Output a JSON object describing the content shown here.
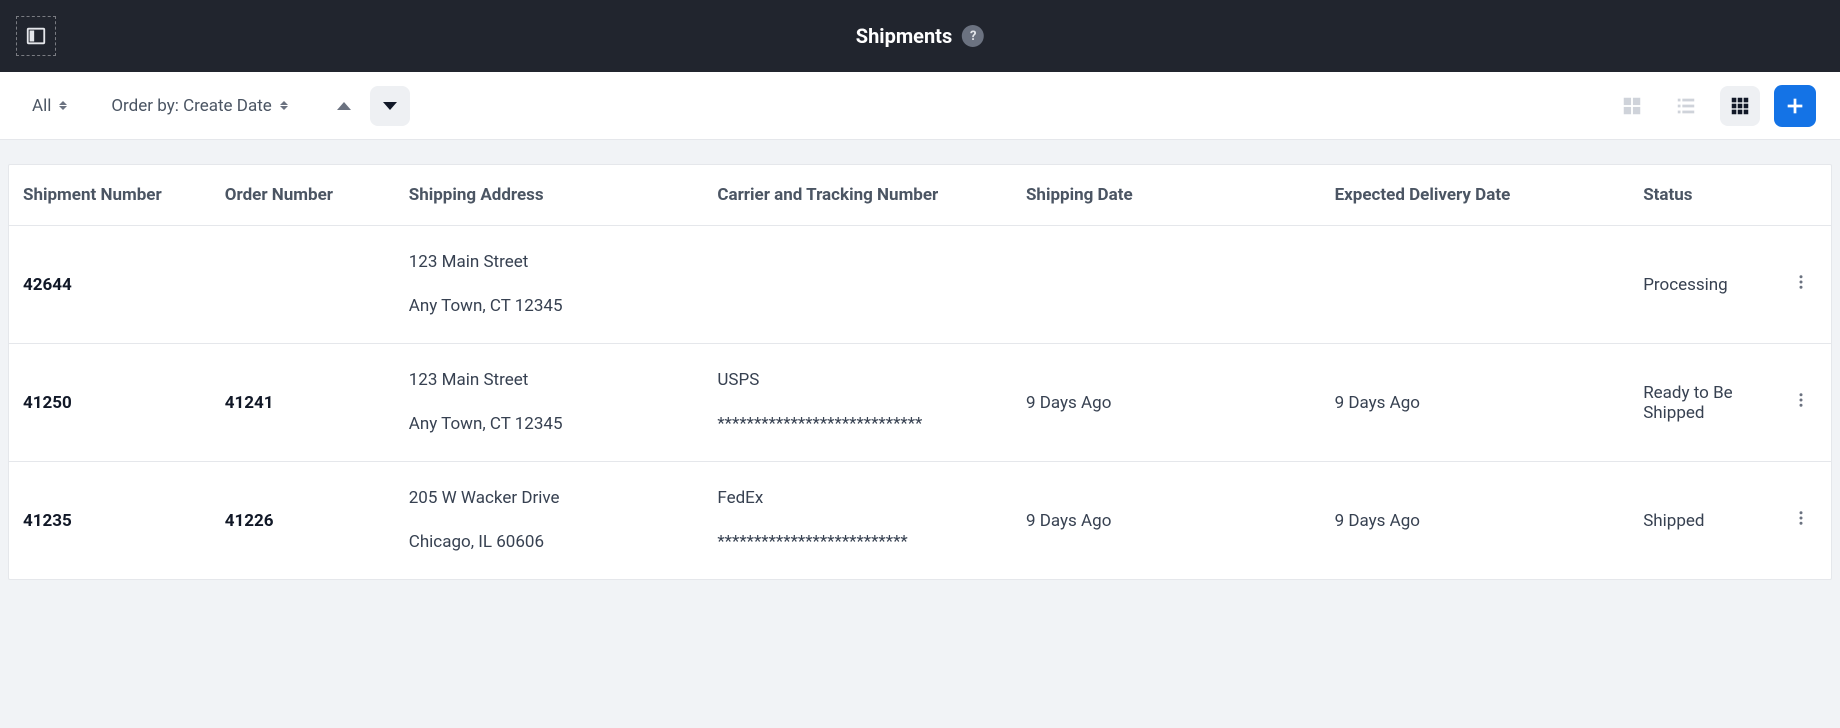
{
  "header": {
    "title": "Shipments",
    "help_label": "?"
  },
  "toolbar": {
    "filter_label": "All",
    "orderby_label": "Order by: Create Date"
  },
  "table": {
    "columns": {
      "shipment_number": "Shipment Number",
      "order_number": "Order Number",
      "shipping_address": "Shipping Address",
      "carrier_tracking": "Carrier and Tracking Number",
      "shipping_date": "Shipping Date",
      "expected_delivery": "Expected Delivery Date",
      "status": "Status"
    },
    "rows": [
      {
        "shipment_number": "42644",
        "order_number": "",
        "address_line1": "123 Main Street",
        "address_line2": "Any Town, CT 12345",
        "carrier": "",
        "tracking": "",
        "shipping_date": "",
        "expected_delivery": "",
        "status": "Processing"
      },
      {
        "shipment_number": "41250",
        "order_number": "41241",
        "address_line1": "123 Main Street",
        "address_line2": "Any Town, CT 12345",
        "carrier": "USPS",
        "tracking": "****************************",
        "shipping_date": "9 Days Ago",
        "expected_delivery": "9 Days Ago",
        "status": "Ready to Be Shipped"
      },
      {
        "shipment_number": "41235",
        "order_number": "41226",
        "address_line1": "205 W Wacker Drive",
        "address_line2": "Chicago, IL 60606",
        "carrier": "FedEx",
        "tracking": "**************************",
        "shipping_date": "9 Days Ago",
        "expected_delivery": "9 Days Ago",
        "status": "Shipped"
      }
    ]
  }
}
